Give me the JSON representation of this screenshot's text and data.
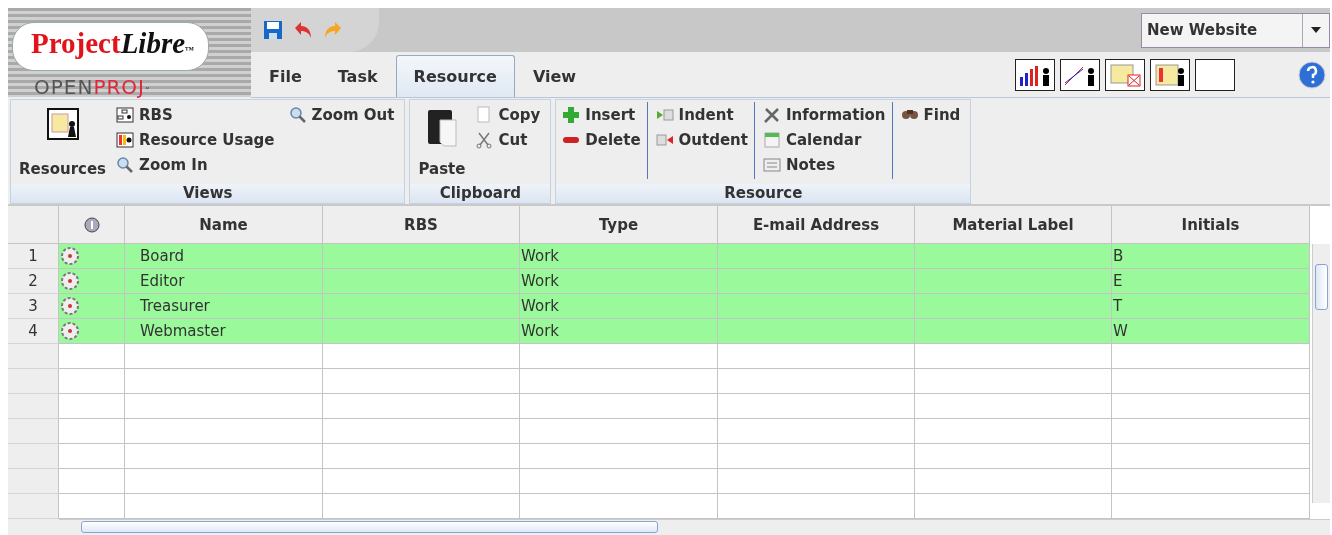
{
  "logo": {
    "name_regular": "Project",
    "name_italic": "Libre",
    "trademark": "™",
    "sub_left": "OPEN",
    "sub_right": "PROJ",
    "sub_mark": "˜"
  },
  "project_select": {
    "value": "New Website"
  },
  "menu_tabs": [
    {
      "label": "File",
      "selected": false
    },
    {
      "label": "Task",
      "selected": false
    },
    {
      "label": "Resource",
      "selected": true
    },
    {
      "label": "View",
      "selected": false
    }
  ],
  "ribbon": {
    "groups": [
      {
        "title": "Views",
        "large": {
          "label": "Resources",
          "kind": "resources"
        },
        "columns": [
          [
            {
              "label": "RBS",
              "kind": "rbs"
            },
            {
              "label": "Resource Usage",
              "kind": "usage"
            },
            {
              "label": "Zoom In",
              "kind": "zoomin"
            }
          ],
          [
            {
              "label": "Zoom Out",
              "kind": "zoomout"
            }
          ]
        ]
      },
      {
        "title": "Clipboard",
        "large": {
          "label": "Paste",
          "kind": "paste"
        },
        "columns": [
          [
            {
              "label": "Copy",
              "kind": "copy"
            },
            {
              "label": "Cut",
              "kind": "cut"
            }
          ]
        ]
      },
      {
        "title": "Resource",
        "columns": [
          [
            {
              "label": "Insert",
              "kind": "insert"
            },
            {
              "label": "Delete",
              "kind": "delete"
            }
          ],
          [
            {
              "label": "Indent",
              "kind": "indent"
            },
            {
              "label": "Outdent",
              "kind": "outdent"
            }
          ],
          [
            {
              "label": "Information",
              "kind": "info"
            },
            {
              "label": "Calendar",
              "kind": "calendar"
            },
            {
              "label": "Notes",
              "kind": "notes"
            }
          ],
          [
            {
              "label": "Find",
              "kind": "find"
            }
          ]
        ]
      }
    ]
  },
  "table": {
    "columns": [
      "Name",
      "RBS",
      "Type",
      "E-mail Address",
      "Material Label",
      "Initials"
    ],
    "rows": [
      {
        "number": "1",
        "name": "Board",
        "rbs": "",
        "type": "Work",
        "email": "",
        "material": "",
        "initials": "B"
      },
      {
        "number": "2",
        "name": "Editor",
        "rbs": "",
        "type": "Work",
        "email": "",
        "material": "",
        "initials": "E"
      },
      {
        "number": "3",
        "name": "Treasurer",
        "rbs": "",
        "type": "Work",
        "email": "",
        "material": "",
        "initials": "T"
      },
      {
        "number": "4",
        "name": "Webmaster",
        "rbs": "",
        "type": "Work",
        "email": "",
        "material": "",
        "initials": "W"
      }
    ]
  }
}
